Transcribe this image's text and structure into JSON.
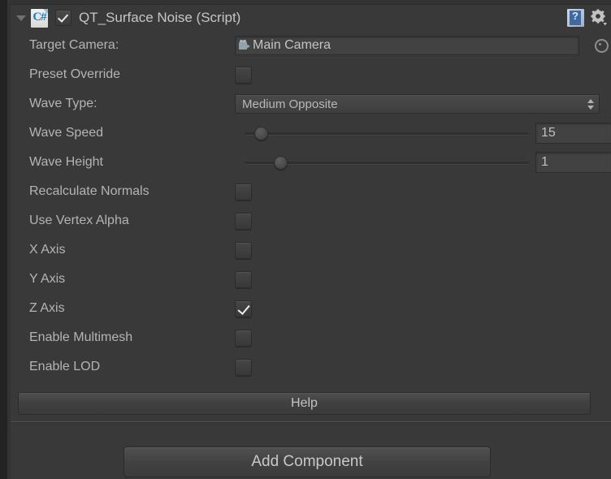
{
  "component": {
    "title": "QT_Surface Noise (Script)",
    "enabled": true,
    "foldout_expanded": true,
    "script_icon": "csharp-script-icon",
    "help_icon": "help-book-icon",
    "settings_icon": "gear-icon"
  },
  "fields": {
    "target_camera": {
      "label": "Target Camera:",
      "value": "Main Camera",
      "icon": "camera-icon",
      "picker_icon": "object-picker-icon"
    },
    "preset_override": {
      "label": "Preset Override",
      "checked": false
    },
    "wave_type": {
      "label": "Wave Type:",
      "value": "Medium Opposite",
      "options": [
        "Medium Opposite"
      ]
    },
    "wave_speed": {
      "label": "Wave Speed",
      "value": "15",
      "slider_percent": 5
    },
    "wave_height": {
      "label": "Wave Height",
      "value": "1",
      "slider_percent": 12
    },
    "recalculate_normals": {
      "label": "Recalculate Normals",
      "checked": false
    },
    "use_vertex_alpha": {
      "label": "Use Vertex Alpha",
      "checked": false
    },
    "x_axis": {
      "label": "X Axis",
      "checked": false
    },
    "y_axis": {
      "label": "Y Axis",
      "checked": false
    },
    "z_axis": {
      "label": "Z Axis",
      "checked": true
    },
    "enable_multimesh": {
      "label": "Enable Multimesh",
      "checked": false
    },
    "enable_lod": {
      "label": "Enable LOD",
      "checked": false
    }
  },
  "buttons": {
    "help": "Help",
    "add_component": "Add Component"
  },
  "colors": {
    "background": "#393939",
    "field_background": "#424242",
    "text": "#b4b4b4",
    "accent_blue": "#1a7fc1"
  }
}
